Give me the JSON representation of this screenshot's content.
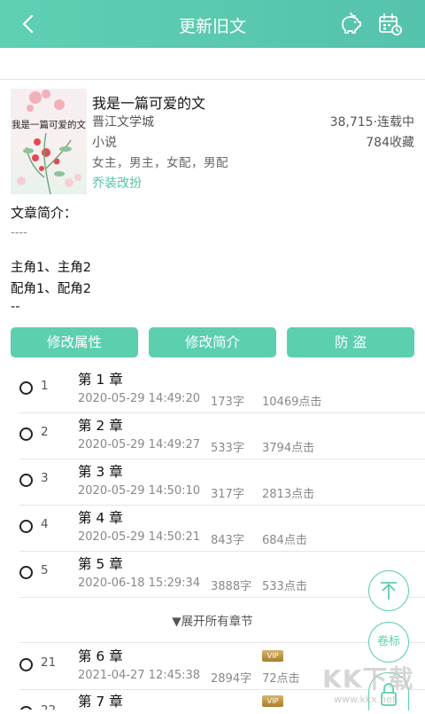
{
  "header": {
    "title": "更新旧文",
    "icons": [
      "back-icon",
      "piggy-bank-icon",
      "calendar-icon"
    ]
  },
  "book": {
    "cover_title": "我是一篇可爱的文",
    "name": "我是一篇可爱的文",
    "site": "晋江文学城",
    "stats_1": "38,715·连载中",
    "type": "小说",
    "stats_2": "784收藏",
    "tags": "女主，男主，女配，男配",
    "category": "乔装改扮"
  },
  "intro": {
    "label": "文章简介：",
    "line1": "----",
    "line2": "主角1、主角2",
    "line3": "配角1、配角2",
    "line4": "--"
  },
  "actions": {
    "edit_attr": "修改属性",
    "edit_intro": "修改简介",
    "anti_theft": "防 盗"
  },
  "chapters": [
    {
      "num": "1",
      "title": "第 1 章",
      "time": "2020-05-29 14:49:20",
      "words": "173字",
      "clicks": "10469点击",
      "vip": false
    },
    {
      "num": "2",
      "title": "第 2 章",
      "time": "2020-05-29 14:49:27",
      "words": "533字",
      "clicks": "3794点击",
      "vip": false
    },
    {
      "num": "3",
      "title": "第 3 章",
      "time": "2020-05-29 14:50:10",
      "words": "317字",
      "clicks": "2813点击",
      "vip": false
    },
    {
      "num": "4",
      "title": "第 4 章",
      "time": "2020-05-29 14:50:21",
      "words": "843字",
      "clicks": "684点击",
      "vip": false
    },
    {
      "num": "5",
      "title": "第 5 章",
      "time": "2020-06-18 15:29:34",
      "words": "3888字",
      "clicks": "533点击",
      "vip": false
    },
    {
      "num": "21",
      "title": "第 6 章",
      "time": "2021-04-27 12:45:38",
      "words": "2894字",
      "clicks": "72点击",
      "vip": true
    },
    {
      "num": "22",
      "title": "第 7 章",
      "time": "",
      "words": "",
      "clicks": "",
      "vip": true
    }
  ],
  "expand_label": "▼展开所有章节",
  "vip_label": "VIP",
  "fab": {
    "volume_label": "卷标"
  },
  "watermark": {
    "text": "KK下载",
    "url": "www.kkx.net"
  },
  "colors": {
    "accent": "#5ccfaf",
    "header": "#5fd0b2"
  }
}
